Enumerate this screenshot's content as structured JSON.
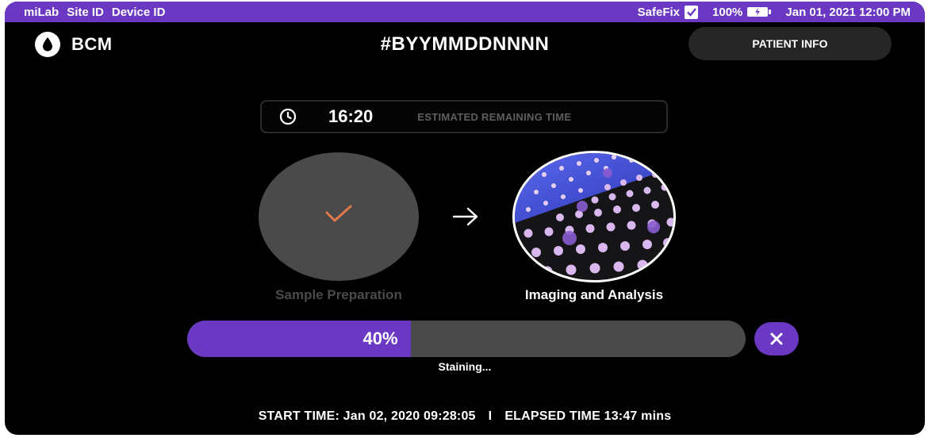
{
  "statusbar": {
    "brand": "miLab",
    "site_id": "Site ID",
    "device_id": "Device ID",
    "safefix": "SafeFix",
    "safefix_checked": true,
    "battery_percent": "100%",
    "battery_icon": "battery-charging-icon",
    "datetime": "Jan 01, 2021 12:00 PM"
  },
  "header": {
    "logo_icon": "drop-icon",
    "app_name": "BCM",
    "order_id": "#BYYMMDDNNNN",
    "patient_info_label": "PATIENT INFO"
  },
  "timer": {
    "icon": "clock-icon",
    "time": "16:20",
    "label": "ESTIMATED REMAINING TIME"
  },
  "steps": [
    {
      "label": "Sample Preparation",
      "status": "completed",
      "icon": "check-icon"
    },
    {
      "label": "Imaging and Analysis",
      "status": "active",
      "icon": "cell-image"
    }
  ],
  "progress": {
    "percent": 40,
    "percent_label": "40%",
    "status": "Staining...",
    "cancel_icon": "close-icon"
  },
  "footer": {
    "start_time": "START TIME: Jan 02, 2020 09:28:05",
    "separator": "I",
    "elapsed_time": "ELAPSED TIME 13:47 mins"
  },
  "colors": {
    "accent": "#6a38c2",
    "background": "#000000",
    "muted": "#4a4a4a",
    "check": "#e0784c"
  }
}
